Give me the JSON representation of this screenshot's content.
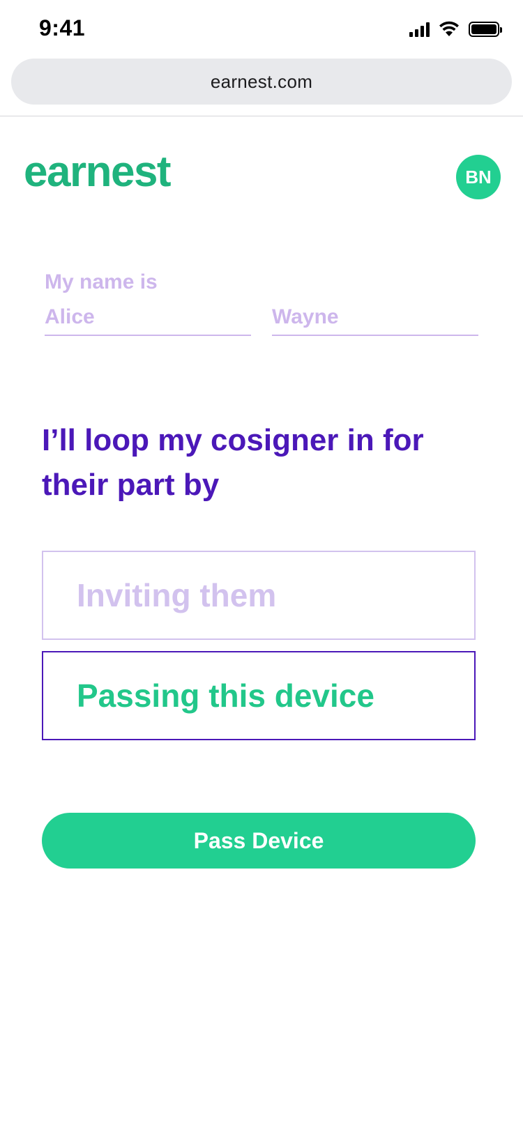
{
  "status_bar": {
    "time": "9:41"
  },
  "browser": {
    "url": "earnest.com"
  },
  "header": {
    "logo_text": "earnest",
    "avatar_initials": "BN"
  },
  "name_section": {
    "label": "My name is",
    "first_name": "Alice",
    "last_name": "Wayne"
  },
  "question": {
    "text": "I’ll loop my cosigner in for their part by"
  },
  "options": [
    {
      "label": "Inviting them",
      "selected": false
    },
    {
      "label": "Passing this device",
      "selected": true
    }
  ],
  "primary_action": {
    "label": "Pass Device"
  },
  "colors": {
    "brand_green": "#22cf91",
    "logo_green": "#1fb37d",
    "purple": "#4b18b8",
    "light_purple": "#cdb6ec"
  },
  "icons": [
    "cellular-signal-icon",
    "wifi-icon",
    "battery-icon"
  ]
}
